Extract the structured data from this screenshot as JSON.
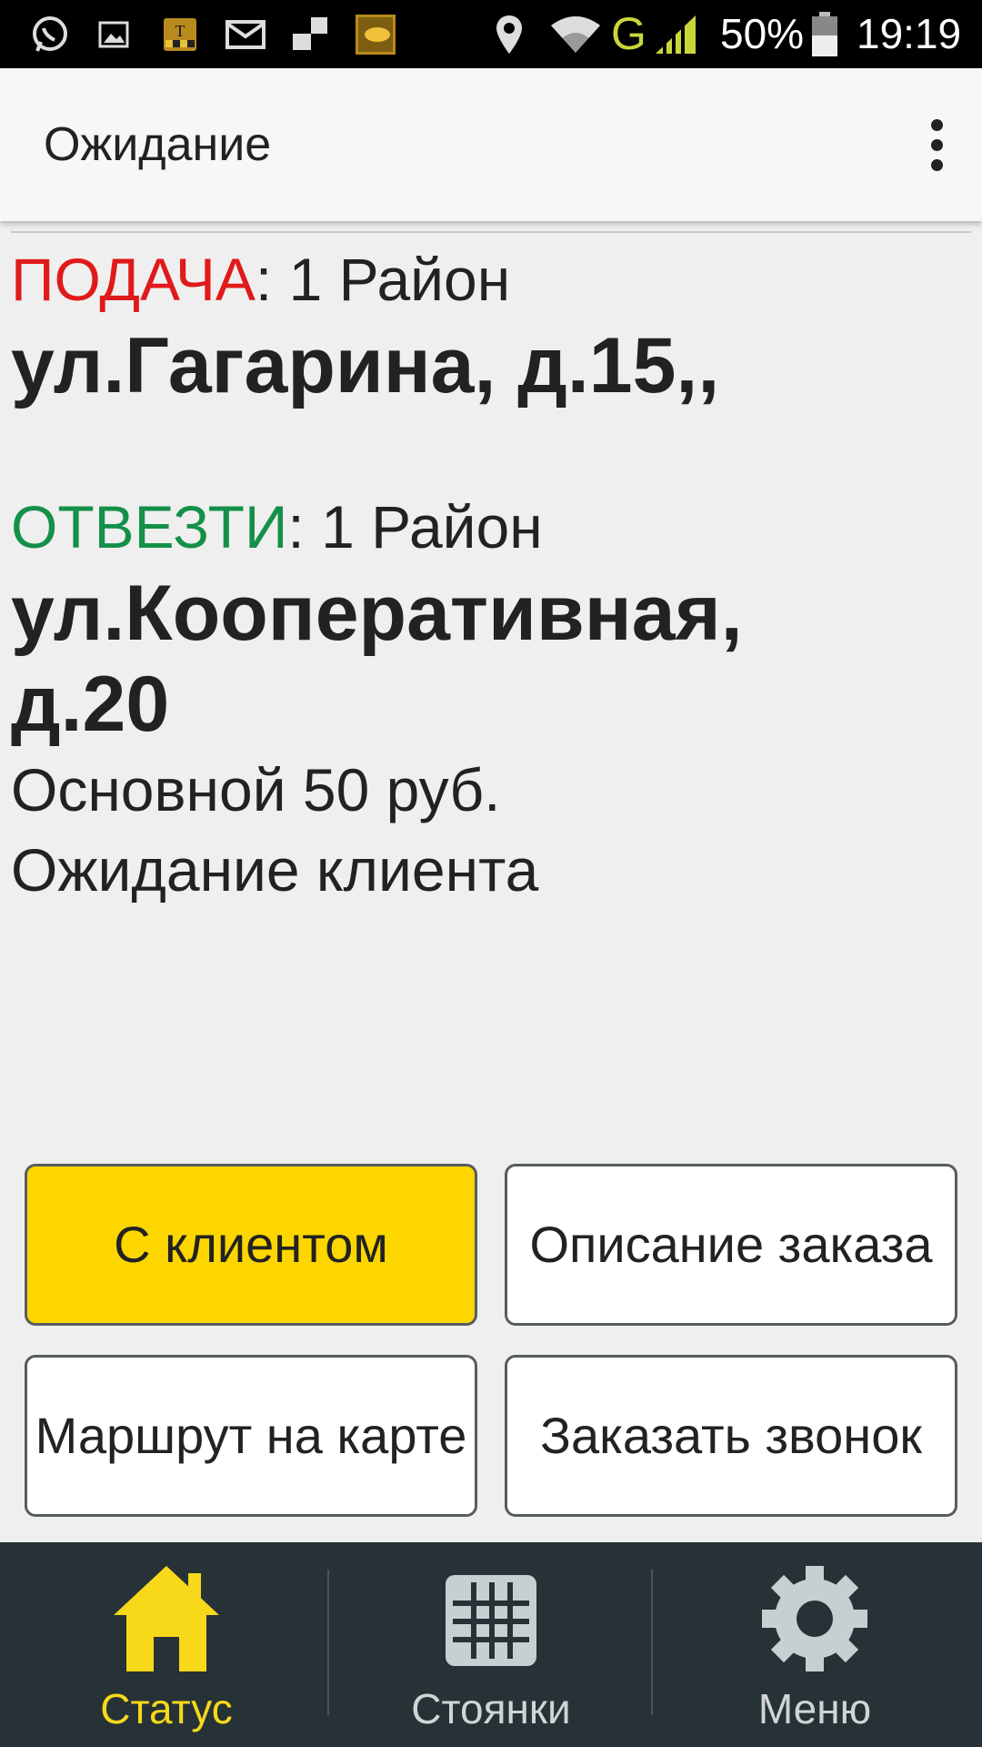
{
  "status_bar": {
    "battery_percent": "50%",
    "time": "19:19",
    "network_type": "G",
    "icons": [
      "whatsapp-icon",
      "image-icon",
      "taxi-icon",
      "mail-icon",
      "signal-block-icon",
      "app-icon",
      "location-icon",
      "wifi-icon",
      "cell-signal-icon",
      "battery-icon"
    ]
  },
  "app_bar": {
    "title": "Ожидание",
    "overflow_icon": "more-vert-icon"
  },
  "order": {
    "pickup_label": "ПОДАЧА",
    "pickup_district": ": 1 Район",
    "pickup_address": "ул.Гагарина, д.15,,",
    "dropoff_label": "ОТВЕЗТИ",
    "dropoff_district": ": 1 Район",
    "dropoff_address": "ул.Кооперативная, д.20",
    "tariff": "Основной 50 руб.",
    "status": "Ожидание клиента"
  },
  "actions": {
    "with_client": "С клиентом",
    "order_description": "Описание заказа",
    "route_on_map": "Маршрут на карте",
    "request_call": "Заказать звонок"
  },
  "bottom_nav": {
    "items": [
      {
        "label": "Статус",
        "icon": "home-icon",
        "active": true
      },
      {
        "label": "Стоянки",
        "icon": "grid-icon",
        "active": false
      },
      {
        "label": "Меню",
        "icon": "gear-icon",
        "active": false
      }
    ]
  },
  "colors": {
    "accent_yellow": "#fdd600",
    "pickup_red": "#e01a1a",
    "dropoff_green": "#149048",
    "nav_background": "#263236",
    "nav_active": "#f7d81a"
  }
}
